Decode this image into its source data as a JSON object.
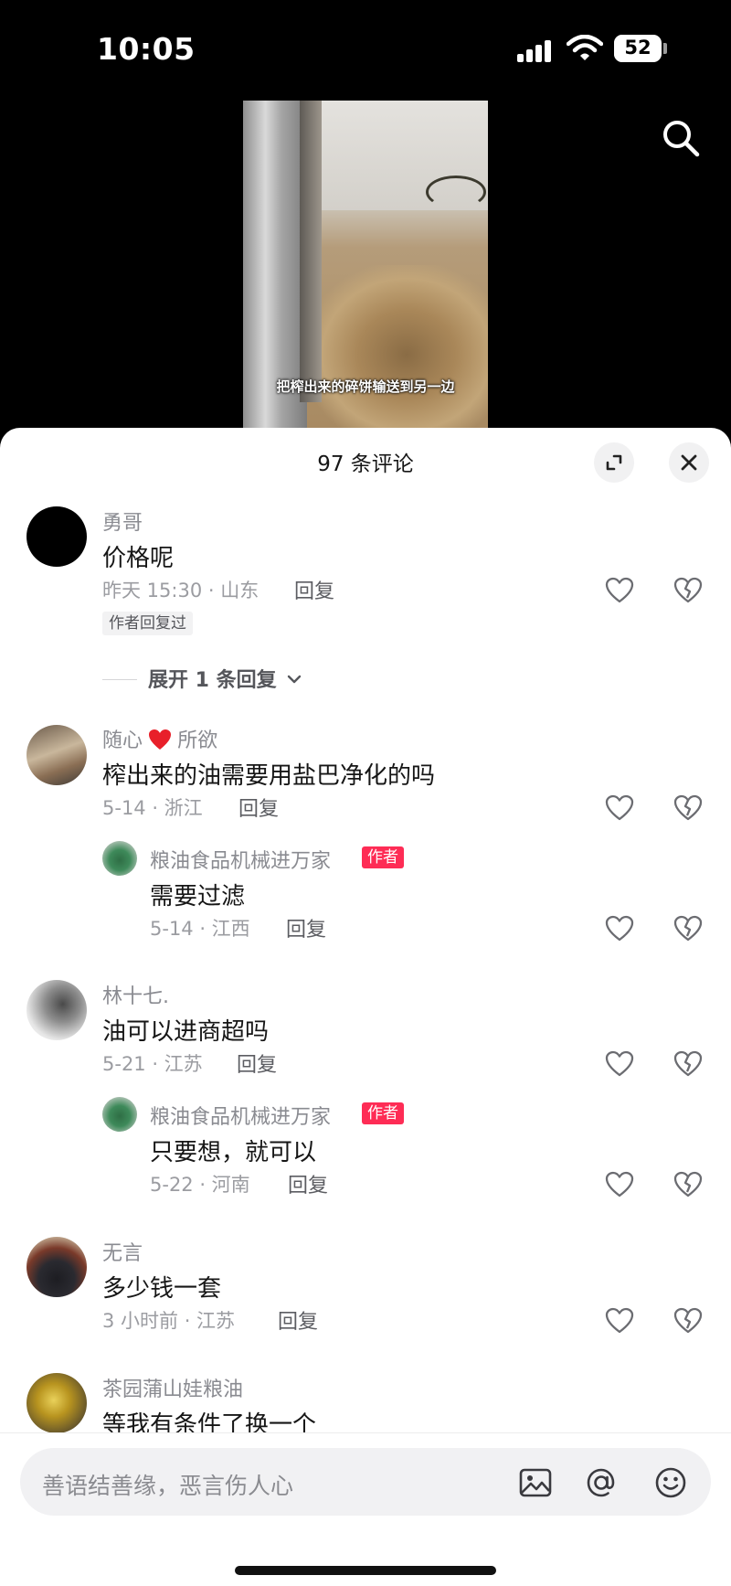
{
  "status_bar": {
    "time": "10:05",
    "battery": "52"
  },
  "video": {
    "caption": "把榨出来的碎饼输送到另一边"
  },
  "comments_header": {
    "title": "97 条评论"
  },
  "comments": [
    {
      "user": "勇哥",
      "text": "价格呢",
      "date": "昨天 15:30 · 山东",
      "reply_label": "回复",
      "tag": "作者回复过",
      "expand": "展开 1 条回复"
    },
    {
      "user": "随心",
      "user_suffix": "所欲",
      "text": "榨出来的油需要用盐巴净化的吗",
      "date": "5-14 · 浙江",
      "reply_label": "回复",
      "replies": [
        {
          "user": "粮油食品机械进万家",
          "badge": "作者",
          "text": "需要过滤",
          "date": "5-14 · 江西",
          "reply_label": "回复"
        }
      ]
    },
    {
      "user": "林十七.",
      "text": "油可以进商超吗",
      "date": "5-21 · 江苏",
      "reply_label": "回复",
      "replies": [
        {
          "user": "粮油食品机械进万家",
          "badge": "作者",
          "text": "只要想，就可以",
          "date": "5-22 · 河南",
          "reply_label": "回复"
        }
      ]
    },
    {
      "user": "无言",
      "text": "多少钱一套",
      "date": "3 小时前 · 江苏",
      "reply_label": "回复"
    },
    {
      "user": "茶园蒲山娃粮油",
      "text": "等我有条件了换一个"
    }
  ],
  "input": {
    "placeholder": "善语结善缘，恶言伤人心"
  },
  "icons": {
    "search": "search-icon",
    "expand": "expand-icon",
    "close": "close-icon",
    "like": "heart-icon",
    "dislike": "broken-heart-icon",
    "image": "image-icon",
    "mention": "at-icon",
    "emoji": "emoji-icon"
  },
  "colors": {
    "author_badge": "#fe2c55",
    "heart_emoji": "#e8202a"
  }
}
